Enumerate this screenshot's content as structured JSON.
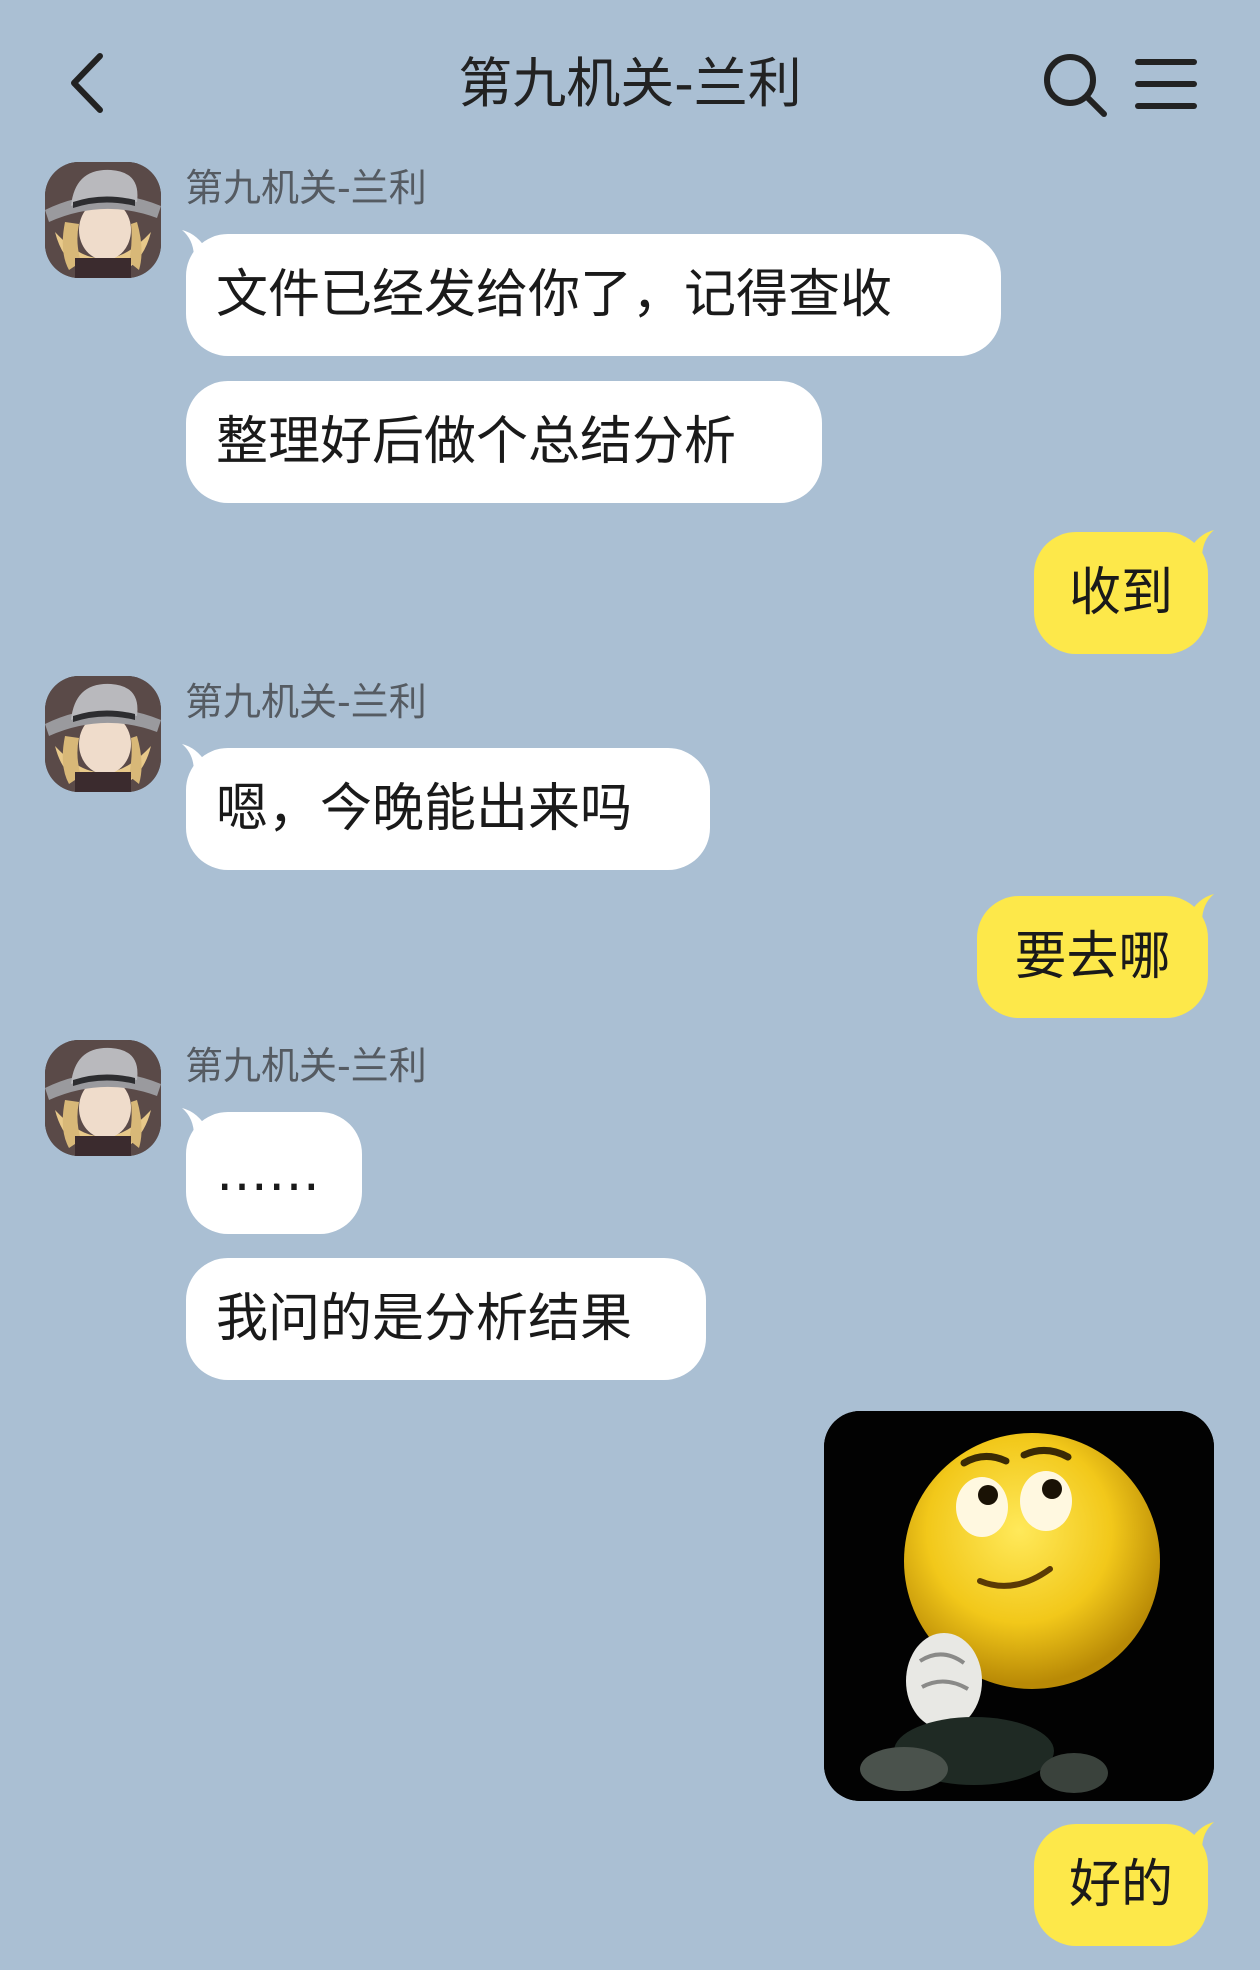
{
  "header": {
    "title": "第九机关-兰利"
  },
  "contact": {
    "name": "第九机关-兰利"
  },
  "messages": {
    "m1": "文件已经发给你了，记得查收",
    "m2": "整理好后做个总结分析",
    "m3": "收到",
    "m4": "嗯，今晚能出来吗",
    "m5": "要去哪",
    "m6": "……",
    "m7": "我问的是分析结果",
    "m8": "好的"
  },
  "colors": {
    "background": "#aabfd3",
    "incoming_bubble": "#ffffff",
    "outgoing_bubble": "#fde84a"
  },
  "icons": {
    "back": "chevron-left-icon",
    "search": "search-icon",
    "menu": "menu-icon",
    "sticker": "thinking-emoji-sticker"
  }
}
